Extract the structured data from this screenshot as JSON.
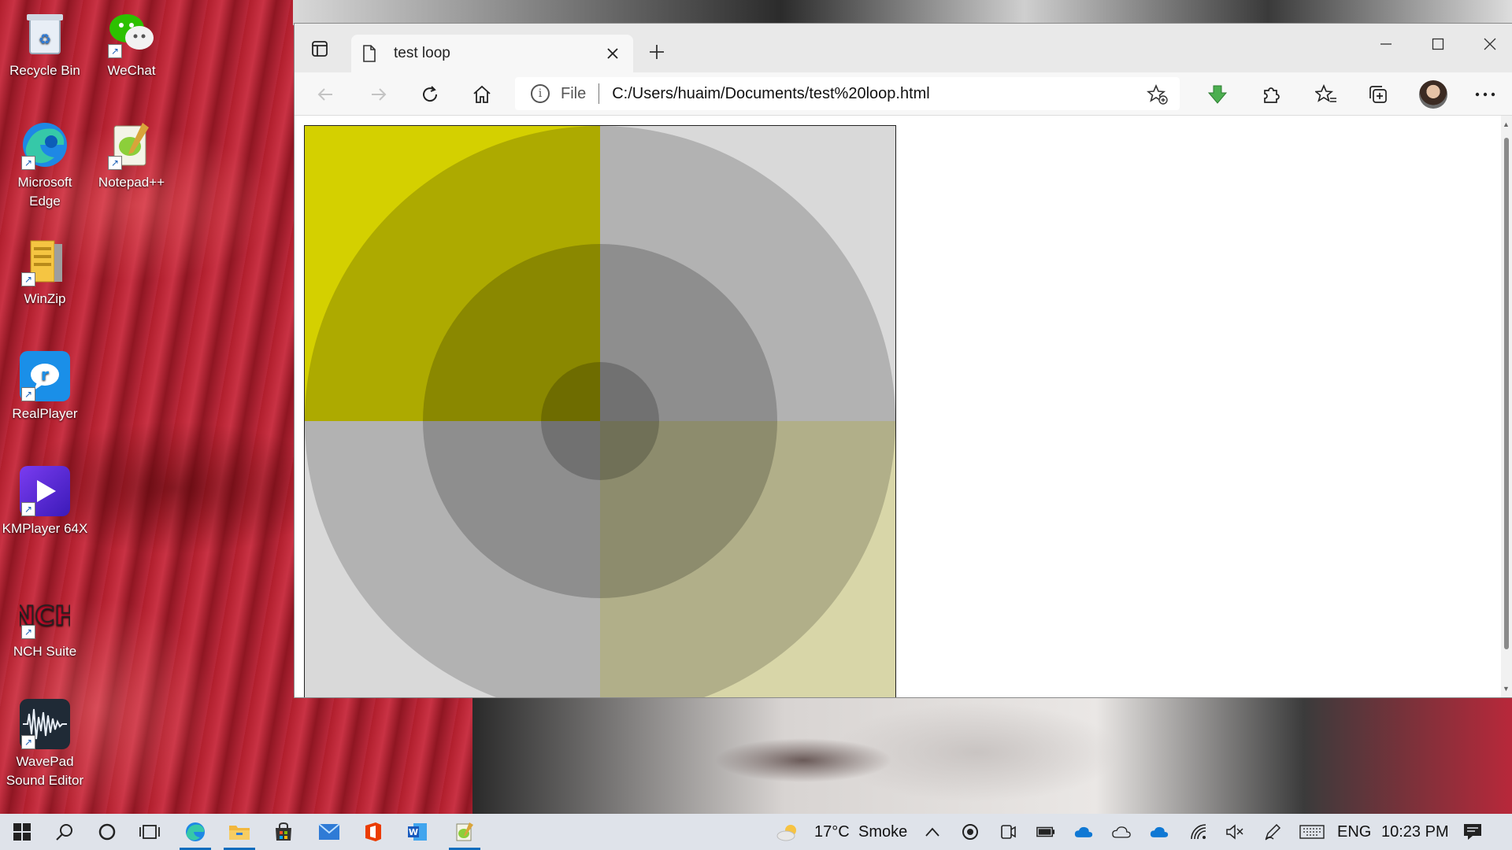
{
  "desktop": {
    "icons": [
      {
        "label": "Recycle Bin",
        "glyph": "recycle-bin-icon"
      },
      {
        "label": "WeChat",
        "glyph": "wechat-icon"
      },
      {
        "label": "Microsoft Edge",
        "glyph": "edge-icon"
      },
      {
        "label": "Notepad++",
        "glyph": "notepad-plus-plus-icon"
      },
      {
        "label": "WinZip",
        "glyph": "winzip-icon"
      },
      {
        "label": "RealPlayer",
        "glyph": "realplayer-icon"
      },
      {
        "label": "KMPlayer 64X",
        "glyph": "kmplayer-icon"
      },
      {
        "label": "NCH Suite",
        "glyph": "nch-suite-icon"
      },
      {
        "label": "WavePad Sound Editor",
        "glyph": "wavepad-icon"
      }
    ]
  },
  "browser": {
    "tab": {
      "title": "test loop"
    },
    "address": {
      "scheme_label": "File",
      "url": "C:/Users/huaim/Documents/test%20loop.html"
    },
    "canvas": {
      "colors": {
        "yellow": "#d4d000",
        "olive": "#aca800",
        "gray_light": "#d9d9d9",
        "gray_mid": "#b3b3b3",
        "gray_dark": "#8c8c8c",
        "khaki": "#d8d6a8"
      }
    }
  },
  "taskbar": {
    "weather": {
      "temp": "17°C",
      "condition": "Smoke"
    },
    "language": "ENG",
    "time": "10:23 PM",
    "apps": [
      "start-icon",
      "search-icon",
      "cortana-icon",
      "task-view-icon",
      "edge-icon",
      "file-explorer-icon",
      "store-icon",
      "mail-icon",
      "office-icon",
      "word-icon",
      "notepad-plus-plus-icon"
    ]
  }
}
